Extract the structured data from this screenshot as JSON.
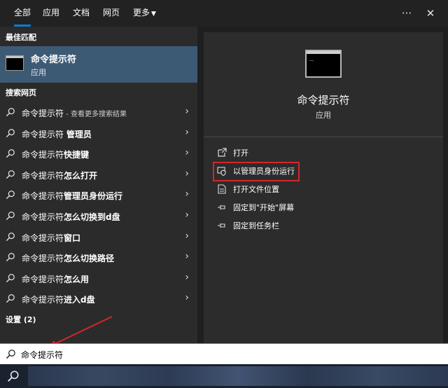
{
  "tabs": [
    {
      "label": "全部",
      "active": true
    },
    {
      "label": "应用",
      "active": false
    },
    {
      "label": "文档",
      "active": false
    },
    {
      "label": "网页",
      "active": false
    },
    {
      "label": "更多",
      "active": false
    }
  ],
  "top_icons": [
    "more-options-icon",
    "close-icon"
  ],
  "top_icon_glyphs": {
    "more": "···",
    "close": "✕"
  },
  "best_match": {
    "section_label": "最佳匹配",
    "title": "命令提示符",
    "subtitle": "应用"
  },
  "web_search": {
    "section_label": "搜索网页",
    "items": [
      {
        "prefix": "命令提示符",
        "bold": "",
        "hint": " - 查看更多搜索结果"
      },
      {
        "prefix": "命令提示符 ",
        "bold": "管理员",
        "hint": ""
      },
      {
        "prefix": "命令提示符",
        "bold": "快捷键",
        "hint": ""
      },
      {
        "prefix": "命令提示符",
        "bold": "怎么打开",
        "hint": ""
      },
      {
        "prefix": "命令提示符",
        "bold": "管理员身份运行",
        "hint": ""
      },
      {
        "prefix": "命令提示符",
        "bold": "怎么切换到d盘",
        "hint": ""
      },
      {
        "prefix": "命令提示符",
        "bold": "窗口",
        "hint": ""
      },
      {
        "prefix": "命令提示符",
        "bold": "怎么切换路径",
        "hint": ""
      },
      {
        "prefix": "命令提示符",
        "bold": "怎么用",
        "hint": ""
      },
      {
        "prefix": "命令提示符",
        "bold": "进入d盘",
        "hint": ""
      }
    ]
  },
  "settings": {
    "section_label": "设置 (2)"
  },
  "detail": {
    "title": "命令提示符",
    "subtitle": "应用",
    "actions": [
      {
        "label": "打开",
        "icon": "open-icon"
      },
      {
        "label": "以管理员身份运行",
        "icon": "shield-icon"
      },
      {
        "label": "打开文件位置",
        "icon": "folder-icon"
      },
      {
        "label": "固定到\"开始\"屏幕",
        "icon": "pin-icon"
      },
      {
        "label": "固定到任务栏",
        "icon": "pin-icon"
      }
    ]
  },
  "search": {
    "value": "命令提示符"
  },
  "colors": {
    "accent": "#0a7ad8",
    "highlight_box": "#d4262b",
    "selected_row": "#3d5a75"
  }
}
